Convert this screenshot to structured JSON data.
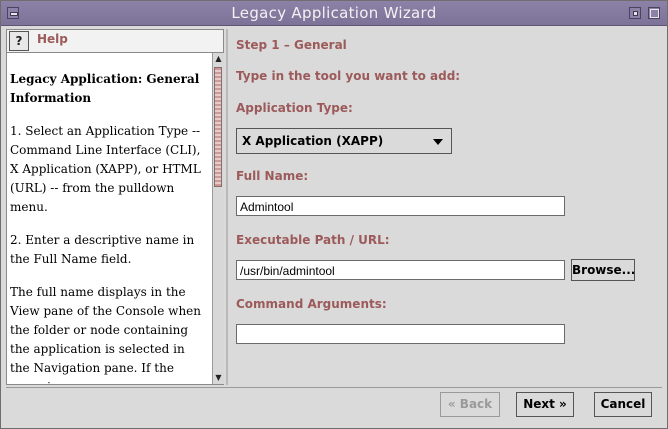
{
  "window": {
    "title": "Legacy Application Wizard"
  },
  "help": {
    "title": "Help",
    "heading": "Legacy Application: General Information",
    "paragraphs": [
      "1. Select an Application Type -- Command Line Interface (CLI), X Application (XAPP), or HTML (URL) -- from the pulldown menu.",
      "2. Enter a descriptive name in the Full Name field.",
      "The full name displays in the View pane of the Console when the folder or node containing the application is selected in the Navigation pane.  If the name is"
    ]
  },
  "form": {
    "step": "Step 1 – General",
    "instruction": "Type in the tool you want to add:",
    "app_type_label": "Application Type:",
    "app_type_value": "X Application (XAPP)",
    "full_name_label": "Full Name:",
    "full_name_value": "Admintool",
    "exec_path_label": "Executable Path / URL:",
    "exec_path_value": "/usr/bin/admintool",
    "browse_label": "Browse...",
    "cmd_args_label": "Command Arguments:",
    "cmd_args_value": ""
  },
  "buttons": {
    "back": "Back",
    "next": "Next",
    "cancel": "Cancel"
  }
}
